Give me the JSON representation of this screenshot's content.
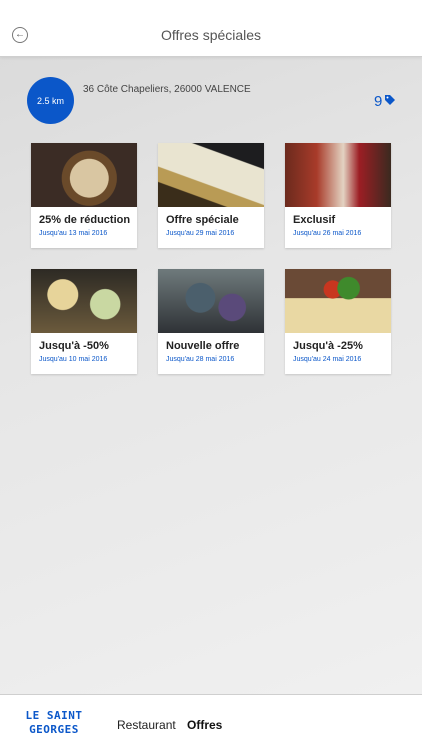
{
  "header": {
    "title": "Offres spéciales",
    "back_icon": "back-arrow-icon"
  },
  "restaurant": {
    "distance": "2.5 km",
    "address": "36 Côte Chapeliers, 26000 VALENCE",
    "offers_count": "9",
    "tag_icon": "tag-icon"
  },
  "offers": [
    {
      "title": "25% de réduction",
      "date": "Jusqu'au 13 mai 2016"
    },
    {
      "title": "Offre spéciale",
      "date": "Jusqu'au 29 mai 2016"
    },
    {
      "title": "Exclusif",
      "date": "Jusqu'au 26 mai 2016"
    },
    {
      "title": "Jusqu'à -50%",
      "date": "Jusqu'au 10 mai 2016"
    },
    {
      "title": "Nouvelle offre",
      "date": "Jusqu'au 28 mai 2016"
    },
    {
      "title": "Jusqu'à -25%",
      "date": "Jusqu'au 24 mai 2016"
    }
  ],
  "bottom_nav": {
    "logo": "LE SAINT GEORGES",
    "restaurant_label": "Restaurant",
    "offres_label": "Offres"
  },
  "colors": {
    "accent": "#0b57c9",
    "background": "#e6e6e6"
  }
}
